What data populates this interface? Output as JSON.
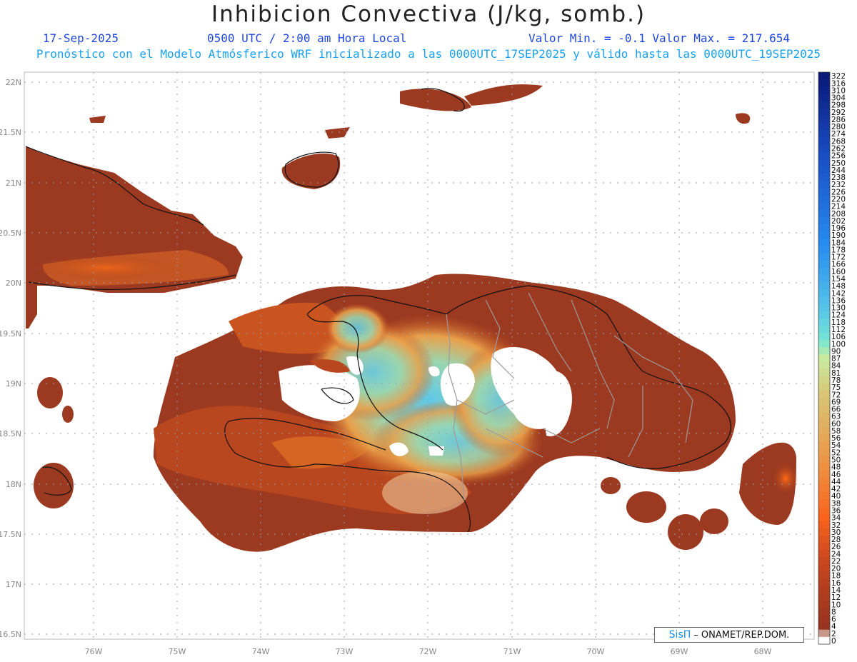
{
  "header": {
    "title": "Inhibicion Convectiva (J/kg, somb.)",
    "date": "17-Sep-2025",
    "time": "0500 UTC / 2:00 am Hora Local",
    "minmax": "Valor Min. = -0.1  Valor Max. = 217.654",
    "model_line": "Pronóstico con el Modelo Atmósferico WRF inicializado a las 0000UTC_17SEP2025 y válido hasta las  0000UTC_19SEP2025"
  },
  "map": {
    "lat_labels": [
      "22N",
      "21.5N",
      "21N",
      "20.5N",
      "20N",
      "19.5N",
      "19N",
      "18.5N",
      "18N",
      "17.5N",
      "17N",
      "16.5N"
    ],
    "lon_labels": [
      "76W",
      "75W",
      "74W",
      "73W",
      "72W",
      "71W",
      "70W",
      "69W",
      "68W"
    ]
  },
  "colorbar": {
    "labels": [
      "322",
      "316",
      "310",
      "304",
      "298",
      "292",
      "286",
      "280",
      "274",
      "268",
      "262",
      "256",
      "250",
      "244",
      "238",
      "232",
      "226",
      "220",
      "214",
      "208",
      "202",
      "196",
      "190",
      "184",
      "178",
      "172",
      "166",
      "160",
      "154",
      "148",
      "142",
      "136",
      "130",
      "124",
      "118",
      "112",
      "106",
      "100",
      "90",
      "87",
      "84",
      "81",
      "78",
      "75",
      "72",
      "69",
      "66",
      "63",
      "60",
      "58",
      "56",
      "54",
      "52",
      "50",
      "48",
      "46",
      "44",
      "42",
      "40",
      "38",
      "36",
      "34",
      "32",
      "30",
      "28",
      "26",
      "24",
      "22",
      "20",
      "18",
      "16",
      "14",
      "12",
      "10",
      "8",
      "6",
      "4",
      "2",
      "0"
    ]
  },
  "credit": {
    "brand": "SisΠ",
    "text": "– ONAMET/REP.DOM."
  }
}
